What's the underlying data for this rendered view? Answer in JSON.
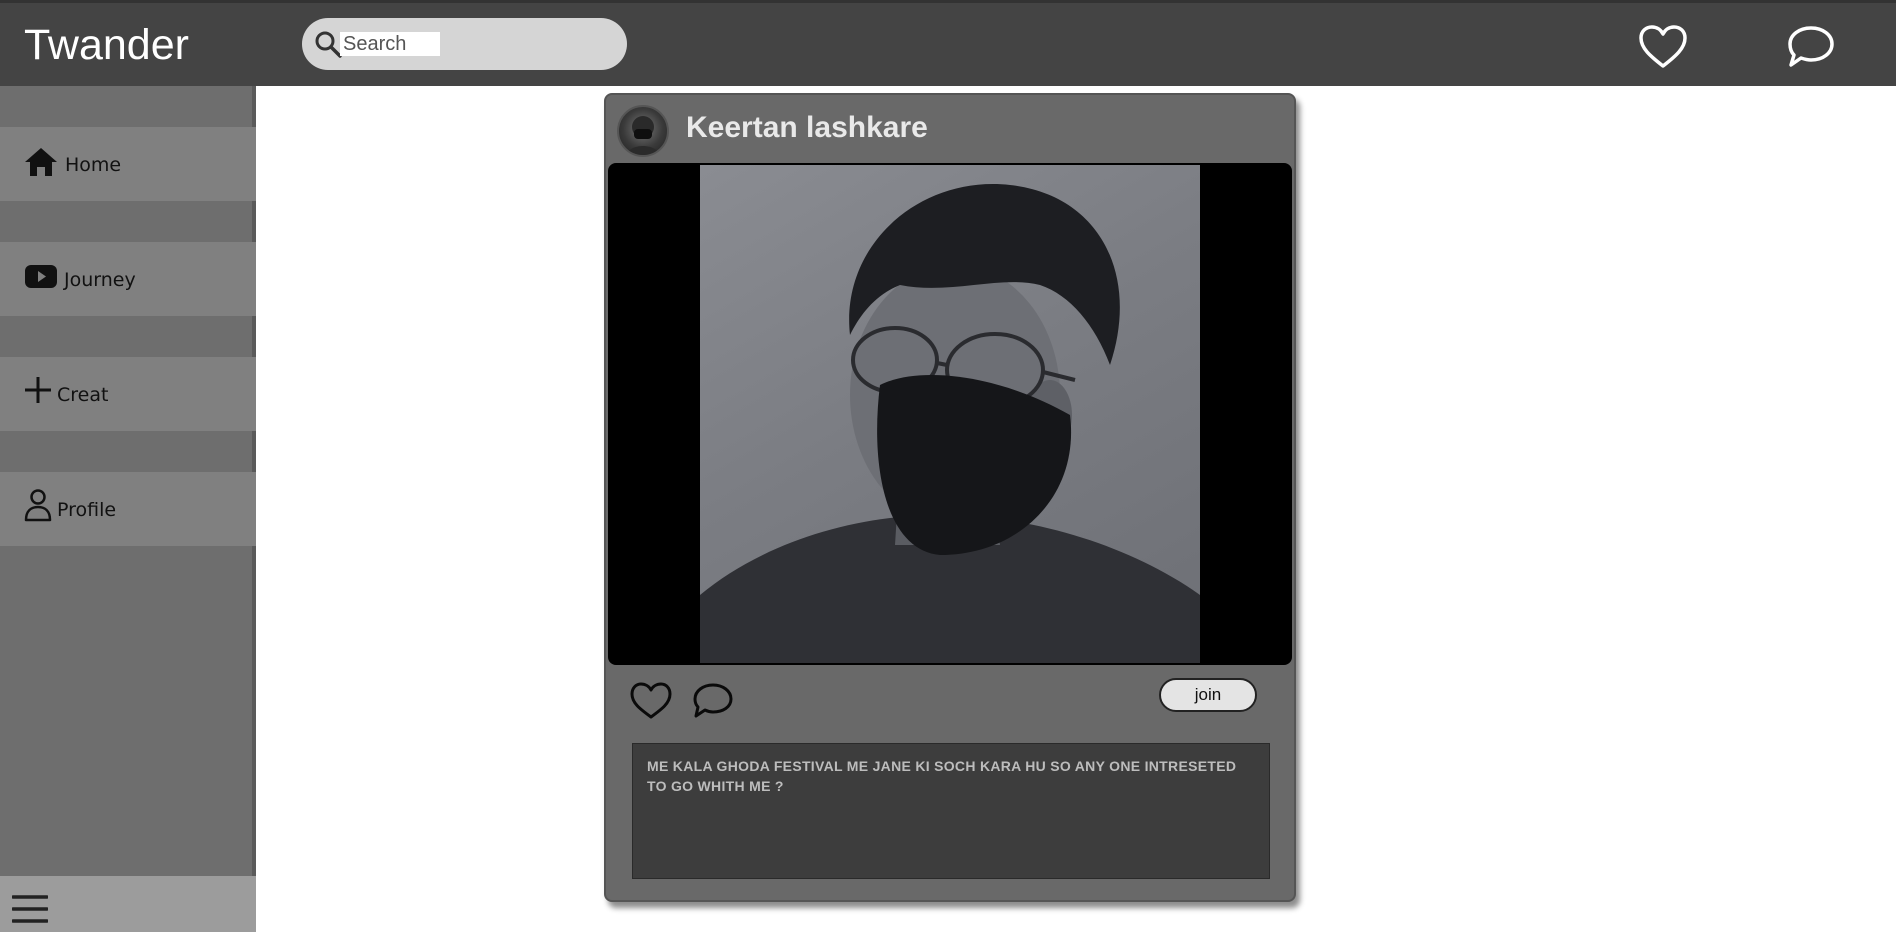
{
  "header": {
    "brand": "Twander",
    "search": {
      "placeholder": "Search",
      "value": ""
    },
    "icons": [
      "heart-icon",
      "chat-icon",
      "search-icon"
    ]
  },
  "sidebar": {
    "items": [
      {
        "label": "Home",
        "icon": "home-icon"
      },
      {
        "label": "Journey",
        "icon": "play-icon"
      },
      {
        "label": "Creat",
        "icon": "plus-icon"
      },
      {
        "label": "Profile",
        "icon": "user-icon"
      }
    ],
    "menu_icon": "hamburger-menu-icon"
  },
  "post": {
    "username": "Keertan lashkare",
    "join_label": "join",
    "caption": "ME KALA GHODA FESTIVAL ME JANE KI SOCH KARA HU SO ANY ONE INTRESETED TO GO WHITH ME ?"
  },
  "colors": {
    "topbar": "#444444",
    "sidebar": "#6e6e6e",
    "nav_item": "#808080",
    "card": "#696969",
    "caption_bg": "#3d3d3d"
  }
}
